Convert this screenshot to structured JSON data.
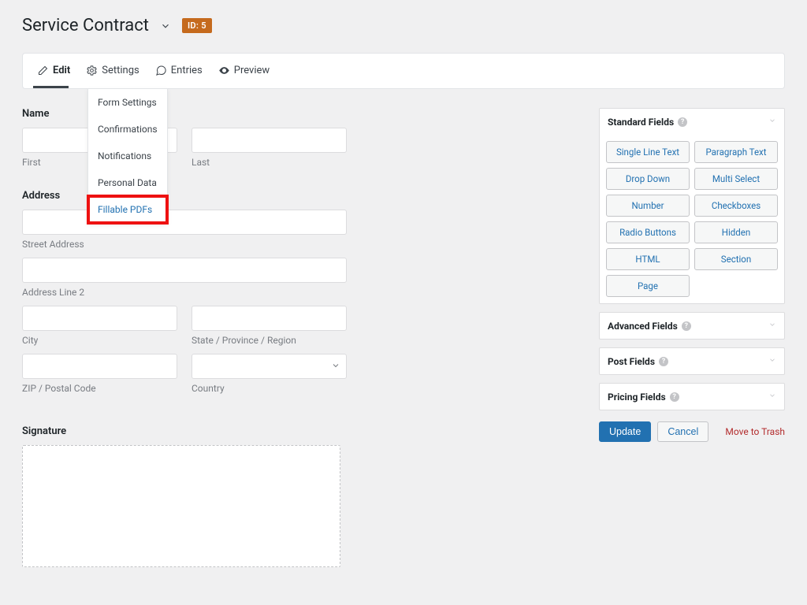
{
  "header": {
    "title": "Service Contract",
    "id_badge": "ID: 5"
  },
  "toolbar": {
    "edit": "Edit",
    "settings": "Settings",
    "entries": "Entries",
    "preview": "Preview"
  },
  "settings_menu": {
    "items": [
      "Form Settings",
      "Confirmations",
      "Notifications",
      "Personal Data",
      "Fillable PDFs"
    ]
  },
  "form": {
    "name": {
      "label": "Name",
      "first": "First",
      "last": "Last"
    },
    "address": {
      "label": "Address",
      "street": "Street Address",
      "line2": "Address Line 2",
      "city": "City",
      "state": "State / Province / Region",
      "zip": "ZIP / Postal Code",
      "country": "Country"
    },
    "signature": {
      "label": "Signature"
    }
  },
  "sidebar": {
    "panels": {
      "standard": {
        "title": "Standard Fields",
        "fields": [
          "Single Line Text",
          "Paragraph Text",
          "Drop Down",
          "Multi Select",
          "Number",
          "Checkboxes",
          "Radio Buttons",
          "Hidden",
          "HTML",
          "Section",
          "Page"
        ]
      },
      "advanced": {
        "title": "Advanced Fields"
      },
      "post": {
        "title": "Post Fields"
      },
      "pricing": {
        "title": "Pricing Fields"
      }
    },
    "actions": {
      "update": "Update",
      "cancel": "Cancel",
      "trash": "Move to Trash"
    }
  }
}
